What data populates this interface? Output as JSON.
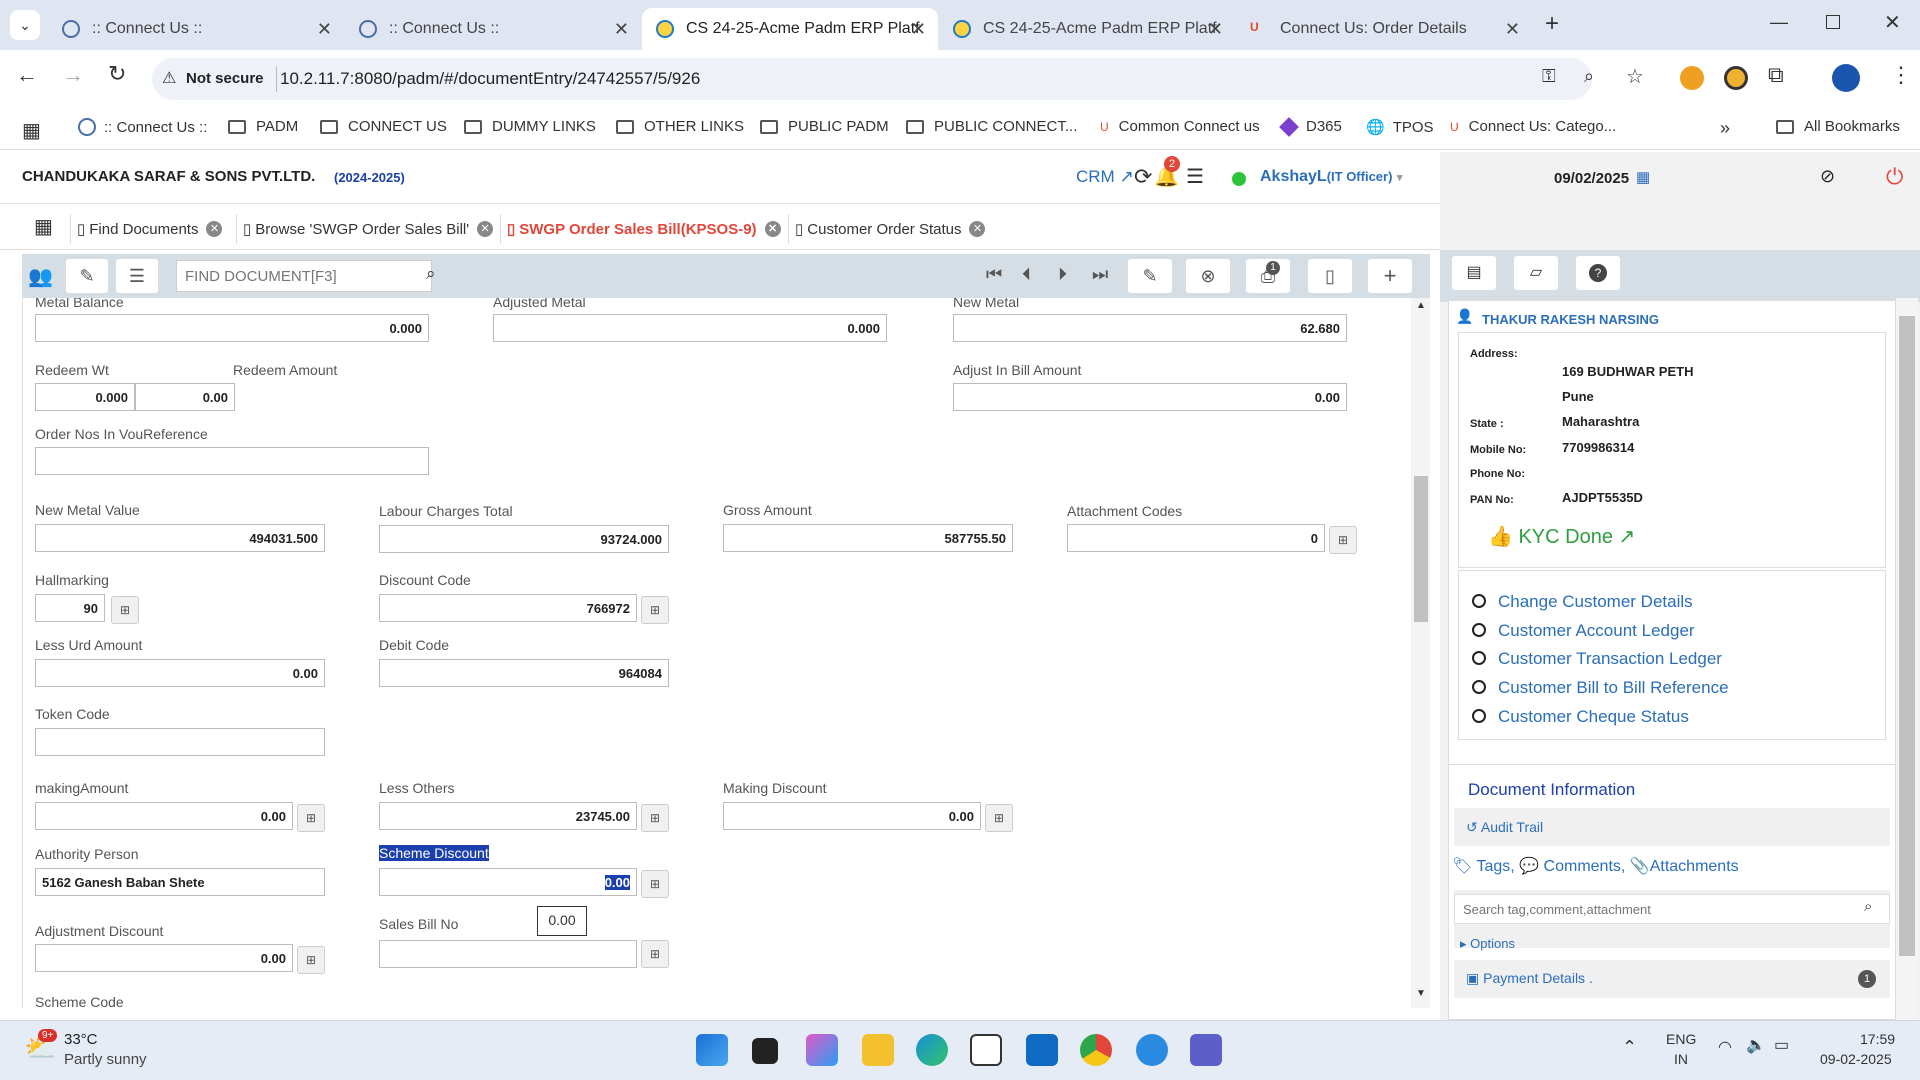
{
  "browser": {
    "tabs": [
      {
        "title": ":: Connect Us ::"
      },
      {
        "title": ":: Connect Us ::"
      },
      {
        "title": "CS 24-25-Acme Padm ERP Platf"
      },
      {
        "title": "CS 24-25-Acme Padm ERP Platf"
      },
      {
        "title": "Connect Us: Order Details"
      }
    ],
    "security_label": "Not secure",
    "url": "10.2.11.7:8080/padm/#/documentEntry/24742557/5/926",
    "bookmarks": [
      ":: Connect Us ::",
      "PADM",
      "CONNECT US",
      "DUMMY LINKS",
      "OTHER LINKS",
      "PUBLIC PADM",
      "PUBLIC CONNECT...",
      "Common Connect us",
      "D365",
      "TPOS",
      "Connect Us: Catego..."
    ],
    "all_bookmarks": "All Bookmarks"
  },
  "app": {
    "company": "CHANDUKAKA SARAF & SONS PVT.LTD.",
    "year": "(2024-2025)",
    "crm": "CRM",
    "notif_count": "2",
    "user": "AkshayL",
    "role": "(IT Officer)",
    "date": "09/02/2025"
  },
  "doc_tabs": [
    "Find Documents",
    "Browse 'SWGP Order Sales Bill'",
    "SWGP Order Sales Bill(KPSOS-9)",
    "Customer Order Status"
  ],
  "toolbar": {
    "find_placeholder": "FIND DOCUMENT[F3]",
    "print_badge": "1"
  },
  "form": {
    "metal_balance": {
      "label": "Metal Balance",
      "value": "0.000"
    },
    "adjusted_metal": {
      "label": "Adjusted Metal",
      "value": "0.000"
    },
    "new_metal": {
      "label": "New Metal",
      "value": "62.680"
    },
    "redeem_wt": {
      "label": "Redeem Wt",
      "value": "0.000"
    },
    "redeem_amount": {
      "label": "Redeem Amount",
      "value": "0.00"
    },
    "adjust_in_bill": {
      "label": "Adjust In Bill Amount",
      "value": "0.00"
    },
    "order_nos": {
      "label": "Order Nos In VouReference",
      "value": ""
    },
    "new_metal_value": {
      "label": "New Metal Value",
      "value": "494031.500"
    },
    "labour_charges": {
      "label": "Labour Charges Total",
      "value": "93724.000"
    },
    "gross_amount": {
      "label": "Gross Amount",
      "value": "587755.50"
    },
    "attachment_codes": {
      "label": "Attachment Codes",
      "value": "0"
    },
    "hallmarking": {
      "label": "Hallmarking",
      "value": "90"
    },
    "discount_code": {
      "label": "Discount Code",
      "value": "766972"
    },
    "less_urd": {
      "label": "Less Urd Amount",
      "value": "0.00"
    },
    "debit_code": {
      "label": "Debit Code",
      "value": "964084"
    },
    "token_code": {
      "label": "Token Code",
      "value": ""
    },
    "making_amount": {
      "label": "makingAmount",
      "value": "0.00"
    },
    "less_others": {
      "label": "Less Others",
      "value": "23745.00"
    },
    "making_discount": {
      "label": "Making Discount",
      "value": "0.00"
    },
    "authority_person": {
      "label": "Authority Person",
      "value": "5162 Ganesh Baban Shete"
    },
    "scheme_discount": {
      "label": "Scheme Discount",
      "value": "0.00"
    },
    "tooltip_value": "0.00",
    "adjustment_discount": {
      "label": "Adjustment Discount",
      "value": "0.00"
    },
    "sales_bill_no": {
      "label": "Sales Bill No",
      "value": ""
    },
    "scheme_code": {
      "label": "Scheme Code"
    }
  },
  "customer": {
    "name": "THAKUR RAKESH NARSING",
    "address_label": "Address:",
    "address1": "169 BUDHWAR PETH",
    "address2": "Pune",
    "state_label": "State :",
    "state": "Maharashtra",
    "mobile_label": "Mobile No:",
    "mobile": "7709986314",
    "phone_label": "Phone No:",
    "phone": "",
    "pan_label": "PAN No:",
    "pan": "AJDPT5535D",
    "kyc": "KYC Done",
    "links": [
      "Change Customer Details",
      "Customer Account Ledger",
      "Customer Transaction Ledger",
      "Customer Bill to Bill Reference",
      "Customer Cheque Status"
    ]
  },
  "doc_info": {
    "title": "Document Information",
    "audit": "Audit Trail",
    "tags": "Tags,",
    "comments": "Comments,",
    "attachments": "Attachments",
    "search_placeholder": "Search tag,comment,attachment",
    "options": "Options",
    "payment": "Payment Details .",
    "payment_count": "1"
  },
  "taskbar": {
    "temp": "33°C",
    "weather": "Partly sunny",
    "weather_badge": "9+",
    "lang1": "ENG",
    "lang2": "IN",
    "time": "17:59",
    "date": "09-02-2025"
  },
  "colors": {
    "accent": "#2a6ebb",
    "active_tab": "#e0463a",
    "kyc": "#2e9e3e",
    "online": "#2ec43a",
    "toolbar": "#d4dee4"
  }
}
